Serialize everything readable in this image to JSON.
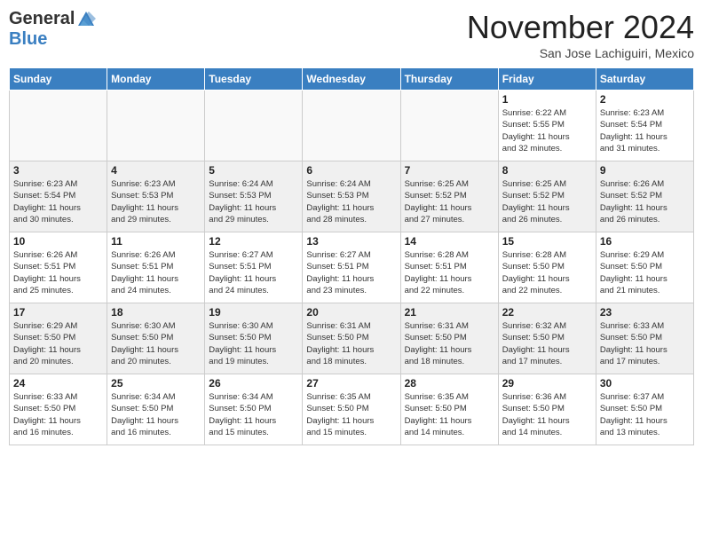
{
  "header": {
    "logo_general": "General",
    "logo_blue": "Blue",
    "month": "November 2024",
    "location": "San Jose Lachiguiri, Mexico"
  },
  "days_of_week": [
    "Sunday",
    "Monday",
    "Tuesday",
    "Wednesday",
    "Thursday",
    "Friday",
    "Saturday"
  ],
  "weeks": [
    [
      {
        "day": "",
        "info": "",
        "empty": true
      },
      {
        "day": "",
        "info": "",
        "empty": true
      },
      {
        "day": "",
        "info": "",
        "empty": true
      },
      {
        "day": "",
        "info": "",
        "empty": true
      },
      {
        "day": "",
        "info": "",
        "empty": true
      },
      {
        "day": "1",
        "info": "Sunrise: 6:22 AM\nSunset: 5:55 PM\nDaylight: 11 hours\nand 32 minutes."
      },
      {
        "day": "2",
        "info": "Sunrise: 6:23 AM\nSunset: 5:54 PM\nDaylight: 11 hours\nand 31 minutes."
      }
    ],
    [
      {
        "day": "3",
        "info": "Sunrise: 6:23 AM\nSunset: 5:54 PM\nDaylight: 11 hours\nand 30 minutes."
      },
      {
        "day": "4",
        "info": "Sunrise: 6:23 AM\nSunset: 5:53 PM\nDaylight: 11 hours\nand 29 minutes."
      },
      {
        "day": "5",
        "info": "Sunrise: 6:24 AM\nSunset: 5:53 PM\nDaylight: 11 hours\nand 29 minutes."
      },
      {
        "day": "6",
        "info": "Sunrise: 6:24 AM\nSunset: 5:53 PM\nDaylight: 11 hours\nand 28 minutes."
      },
      {
        "day": "7",
        "info": "Sunrise: 6:25 AM\nSunset: 5:52 PM\nDaylight: 11 hours\nand 27 minutes."
      },
      {
        "day": "8",
        "info": "Sunrise: 6:25 AM\nSunset: 5:52 PM\nDaylight: 11 hours\nand 26 minutes."
      },
      {
        "day": "9",
        "info": "Sunrise: 6:26 AM\nSunset: 5:52 PM\nDaylight: 11 hours\nand 26 minutes."
      }
    ],
    [
      {
        "day": "10",
        "info": "Sunrise: 6:26 AM\nSunset: 5:51 PM\nDaylight: 11 hours\nand 25 minutes."
      },
      {
        "day": "11",
        "info": "Sunrise: 6:26 AM\nSunset: 5:51 PM\nDaylight: 11 hours\nand 24 minutes."
      },
      {
        "day": "12",
        "info": "Sunrise: 6:27 AM\nSunset: 5:51 PM\nDaylight: 11 hours\nand 24 minutes."
      },
      {
        "day": "13",
        "info": "Sunrise: 6:27 AM\nSunset: 5:51 PM\nDaylight: 11 hours\nand 23 minutes."
      },
      {
        "day": "14",
        "info": "Sunrise: 6:28 AM\nSunset: 5:51 PM\nDaylight: 11 hours\nand 22 minutes."
      },
      {
        "day": "15",
        "info": "Sunrise: 6:28 AM\nSunset: 5:50 PM\nDaylight: 11 hours\nand 22 minutes."
      },
      {
        "day": "16",
        "info": "Sunrise: 6:29 AM\nSunset: 5:50 PM\nDaylight: 11 hours\nand 21 minutes."
      }
    ],
    [
      {
        "day": "17",
        "info": "Sunrise: 6:29 AM\nSunset: 5:50 PM\nDaylight: 11 hours\nand 20 minutes."
      },
      {
        "day": "18",
        "info": "Sunrise: 6:30 AM\nSunset: 5:50 PM\nDaylight: 11 hours\nand 20 minutes."
      },
      {
        "day": "19",
        "info": "Sunrise: 6:30 AM\nSunset: 5:50 PM\nDaylight: 11 hours\nand 19 minutes."
      },
      {
        "day": "20",
        "info": "Sunrise: 6:31 AM\nSunset: 5:50 PM\nDaylight: 11 hours\nand 18 minutes."
      },
      {
        "day": "21",
        "info": "Sunrise: 6:31 AM\nSunset: 5:50 PM\nDaylight: 11 hours\nand 18 minutes."
      },
      {
        "day": "22",
        "info": "Sunrise: 6:32 AM\nSunset: 5:50 PM\nDaylight: 11 hours\nand 17 minutes."
      },
      {
        "day": "23",
        "info": "Sunrise: 6:33 AM\nSunset: 5:50 PM\nDaylight: 11 hours\nand 17 minutes."
      }
    ],
    [
      {
        "day": "24",
        "info": "Sunrise: 6:33 AM\nSunset: 5:50 PM\nDaylight: 11 hours\nand 16 minutes."
      },
      {
        "day": "25",
        "info": "Sunrise: 6:34 AM\nSunset: 5:50 PM\nDaylight: 11 hours\nand 16 minutes."
      },
      {
        "day": "26",
        "info": "Sunrise: 6:34 AM\nSunset: 5:50 PM\nDaylight: 11 hours\nand 15 minutes."
      },
      {
        "day": "27",
        "info": "Sunrise: 6:35 AM\nSunset: 5:50 PM\nDaylight: 11 hours\nand 15 minutes."
      },
      {
        "day": "28",
        "info": "Sunrise: 6:35 AM\nSunset: 5:50 PM\nDaylight: 11 hours\nand 14 minutes."
      },
      {
        "day": "29",
        "info": "Sunrise: 6:36 AM\nSunset: 5:50 PM\nDaylight: 11 hours\nand 14 minutes."
      },
      {
        "day": "30",
        "info": "Sunrise: 6:37 AM\nSunset: 5:50 PM\nDaylight: 11 hours\nand 13 minutes."
      }
    ]
  ]
}
